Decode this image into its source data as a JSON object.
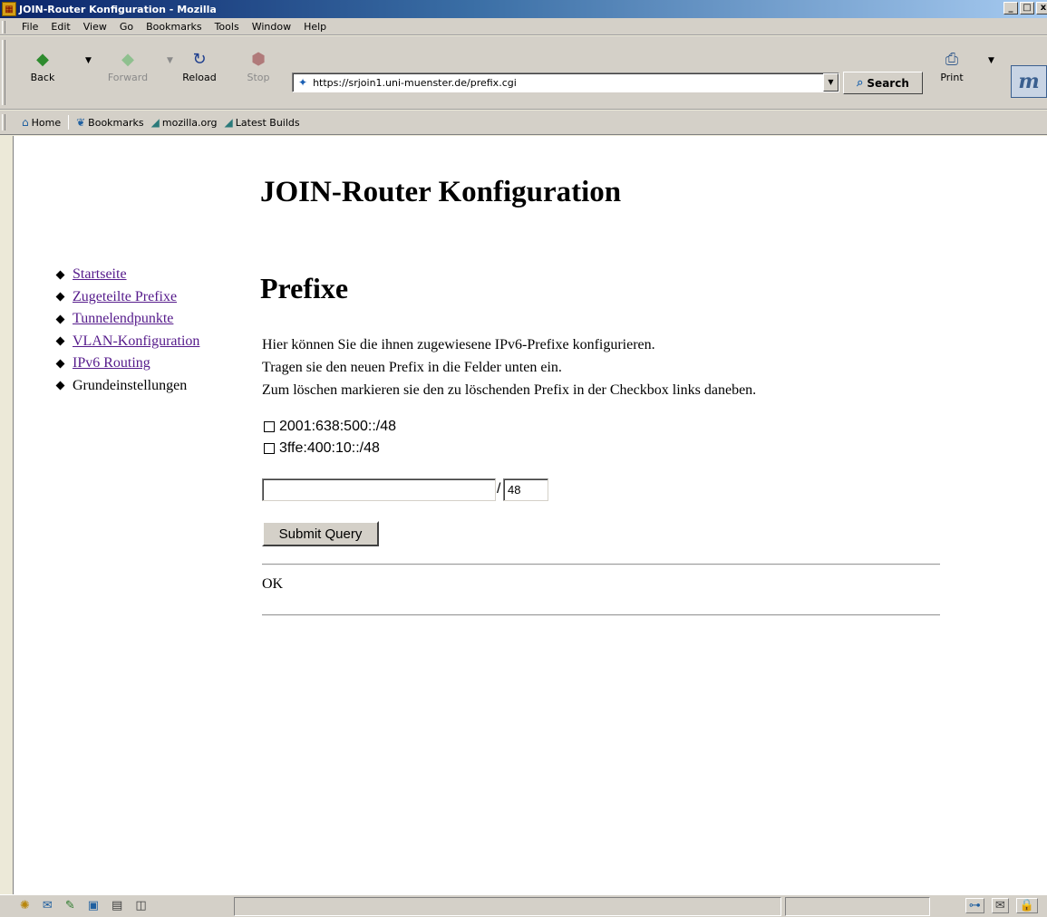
{
  "window": {
    "title": "JOIN-Router Konfiguration - Mozilla",
    "controls": [
      "_",
      "□",
      "x"
    ]
  },
  "menu": [
    "File",
    "Edit",
    "View",
    "Go",
    "Bookmarks",
    "Tools",
    "Window",
    "Help"
  ],
  "toolbar": {
    "back": "Back",
    "forward": "Forward",
    "reload": "Reload",
    "stop": "Stop",
    "url": "https://srjoin1.uni-muenster.de/prefix.cgi",
    "search": "Search",
    "print": "Print"
  },
  "bookmarks": [
    "Home",
    "Bookmarks",
    "mozilla.org",
    "Latest Builds"
  ],
  "page": {
    "heading": "JOIN-Router Konfiguration",
    "section_title": "Prefixe",
    "nav": [
      {
        "label": "Startseite",
        "link": true
      },
      {
        "label": "Zugeteilte Prefixe",
        "link": true
      },
      {
        "label": "Tunnelendpunkte",
        "link": true
      },
      {
        "label": "VLAN-Konfiguration",
        "link": true
      },
      {
        "label": "IPv6 Routing",
        "link": true
      },
      {
        "label": "Grundeinstellungen",
        "link": false
      }
    ],
    "intro": [
      "Hier können Sie die ihnen zugewiesene IPv6-Prefixe konfigurieren.",
      "Tragen sie den neuen Prefix in die Felder unten ein.",
      "Zum löschen markieren sie den zu löschenden Prefix in der Checkbox links daneben."
    ],
    "prefixes": [
      "2001:638:500::/48",
      "3ffe:400:10::/48"
    ],
    "new_prefix": {
      "value": "",
      "separator": "/",
      "length": "48"
    },
    "submit_label": "Submit Query",
    "status": "OK"
  },
  "colors": {
    "visited_link": "#551a8b",
    "chrome": "#d4d0c8",
    "titlebar": "#0a246a"
  }
}
